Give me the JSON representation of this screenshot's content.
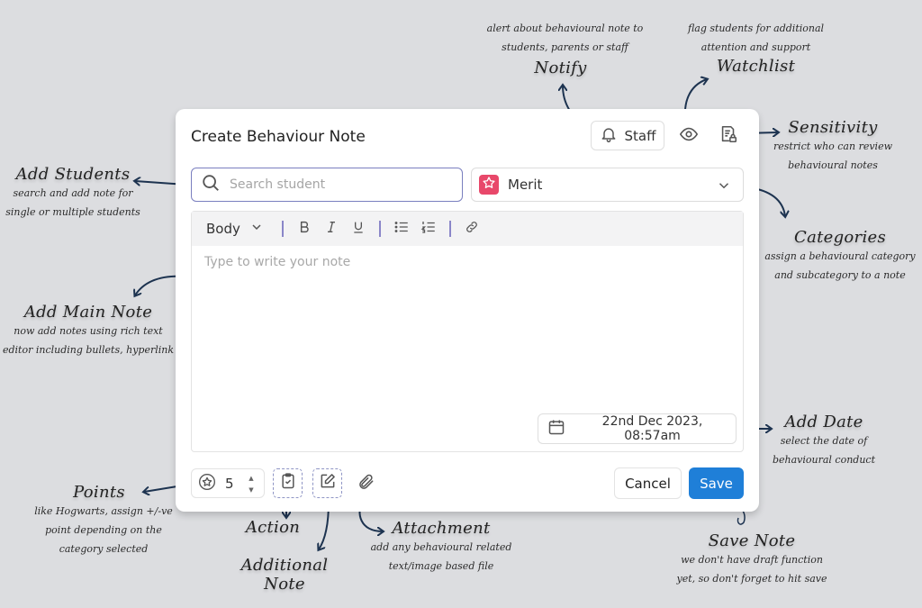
{
  "modal": {
    "title": "Create Behaviour Note",
    "notify_button": {
      "label": "Staff",
      "icon": "bell-icon"
    },
    "watchlist_icon": "eye-icon",
    "sensitivity_icon": "document-lock-icon",
    "search": {
      "placeholder": "Search student",
      "value": "",
      "icon": "search-icon"
    },
    "category": {
      "selected": "Merit",
      "icon": "star-icon",
      "accent": "#e8486a"
    },
    "toolbar": {
      "text_style": "Body",
      "buttons": [
        {
          "name": "bold",
          "glyph": "B"
        },
        {
          "name": "italic",
          "glyph": "I"
        },
        {
          "name": "underline",
          "glyph": "U"
        },
        {
          "name": "bullet-list",
          "glyph": "bullets"
        },
        {
          "name": "numbered-list",
          "glyph": "numbers"
        },
        {
          "name": "link",
          "glyph": "link"
        }
      ]
    },
    "note": {
      "placeholder": "Type to write your note",
      "value": ""
    },
    "date": {
      "value": "22nd Dec 2023, 08:57am",
      "icon": "calendar-icon"
    },
    "points": {
      "value": "5",
      "icon": "star-circle-icon"
    },
    "cancel_label": "Cancel",
    "save_label": "Save",
    "save_color": "#1f7fd8"
  },
  "annotations": {
    "notify": {
      "title": "Notify",
      "desc1": "alert about behavioural note to",
      "desc2": "students, parents or staff"
    },
    "watchlist": {
      "title": "Watchlist",
      "desc1": "flag students for additional",
      "desc2": "attention and support"
    },
    "sensitivity": {
      "title": "Sensitivity",
      "desc1": "restrict who can review",
      "desc2": "behavioural notes"
    },
    "add_students": {
      "title": "Add Students",
      "desc1": "search and add note for",
      "desc2": "single or multiple students"
    },
    "categories": {
      "title": "Categories",
      "desc1": "assign a behavioural category",
      "desc2": "and subcategory to a note"
    },
    "main_note": {
      "title": "Add Main Note",
      "desc1": "now add notes using rich text",
      "desc2": "editor including bullets, hyperlink"
    },
    "add_date": {
      "title": "Add Date",
      "desc1": "select the date of",
      "desc2": "behavioural conduct"
    },
    "points": {
      "title": "Points",
      "desc1": "like Hogwarts, assign +/-ve",
      "desc2": "point depending on the",
      "desc3": "category selected"
    },
    "action": {
      "title": "Action"
    },
    "additional_note": {
      "title": "Additional Note"
    },
    "attachment": {
      "title": "Attachment",
      "desc1": "add any behavioural related",
      "desc2": "text/image based file"
    },
    "save_note": {
      "title": "Save Note",
      "desc1": "we don't have draft function",
      "desc2": "yet, so don't forget to hit save"
    }
  }
}
